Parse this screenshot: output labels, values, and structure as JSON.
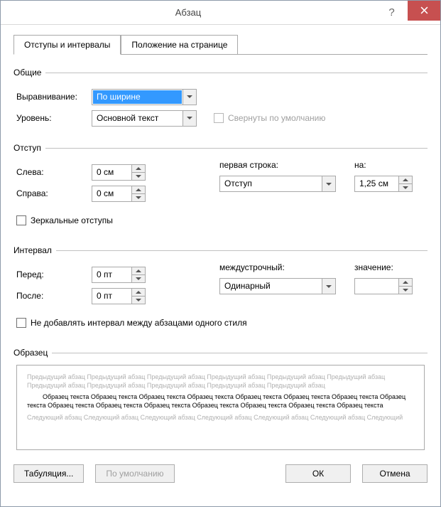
{
  "window": {
    "title": "Абзац"
  },
  "tabs": {
    "t1": "Отступы и интервалы",
    "t2": "Положение на странице"
  },
  "general": {
    "legend": "Общие",
    "alignment_label": "Выравнивание:",
    "alignment_value": "По ширине",
    "level_label": "Уровень:",
    "level_value": "Основной текст",
    "collapsed_label": "Свернуты по умолчанию"
  },
  "indent": {
    "legend": "Отступ",
    "left_label": "Слева:",
    "left_value": "0 см",
    "right_label": "Справа:",
    "right_value": "0 см",
    "firstline_label": "первая строка:",
    "firstline_value": "Отступ",
    "by_label": "на:",
    "by_value": "1,25 см",
    "mirror_label": "Зеркальные отступы"
  },
  "spacing": {
    "legend": "Интервал",
    "before_label": "Перед:",
    "before_value": "0 пт",
    "after_label": "После:",
    "after_value": "0 пт",
    "linespacing_label": "междустрочный:",
    "linespacing_value": "Одинарный",
    "at_label": "значение:",
    "at_value": "",
    "noadd_label": "Не добавлять интервал между абзацами одного стиля"
  },
  "preview": {
    "legend": "Образец",
    "prev_text": "Предыдущий абзац Предыдущий абзац Предыдущий абзац Предыдущий абзац Предыдущий абзац Предыдущий абзац Предыдущий абзац Предыдущий абзац Предыдущий абзац Предыдущий абзац Предыдущий абзац",
    "sample_text": "Образец текста Образец текста Образец текста Образец текста Образец текста Образец текста Образец текста Образец текста Образец текста Образец текста Образец текста Образец текста Образец текста Образец текста Образец текста",
    "next_text": "Следующий абзац Следующий абзац Следующий абзац Следующий абзац Следующий абзац Следующий абзац Следующий"
  },
  "buttons": {
    "tabs": "Табуляция...",
    "default": "По умолчанию",
    "ok": "ОК",
    "cancel": "Отмена"
  }
}
